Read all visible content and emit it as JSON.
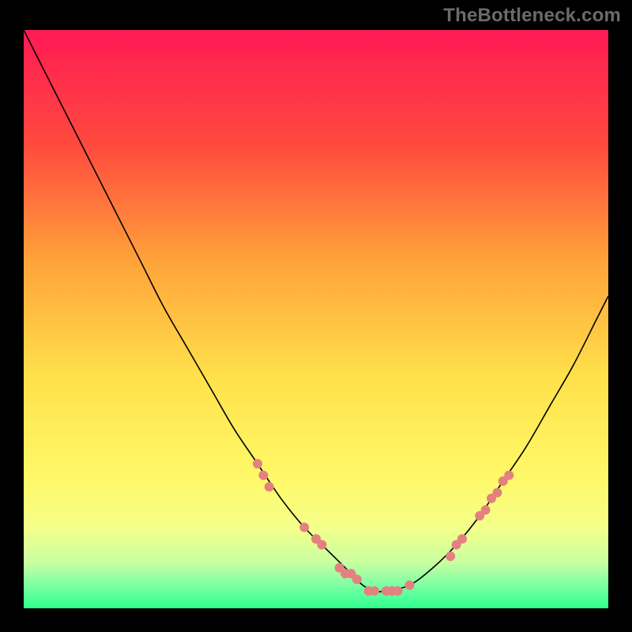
{
  "watermark": "TheBottleneck.com",
  "chart_data": {
    "type": "line",
    "title": "",
    "xlabel": "",
    "ylabel": "",
    "xlim": [
      0,
      100
    ],
    "ylim": [
      0,
      100
    ],
    "gradient_stops": [
      {
        "offset": 0,
        "color": "#ff1a54"
      },
      {
        "offset": 20,
        "color": "#ff4a3e"
      },
      {
        "offset": 40,
        "color": "#ffa33a"
      },
      {
        "offset": 60,
        "color": "#ffe14a"
      },
      {
        "offset": 78,
        "color": "#fff96a"
      },
      {
        "offset": 86,
        "color": "#f4ff8a"
      },
      {
        "offset": 92,
        "color": "#c9ffa0"
      },
      {
        "offset": 96,
        "color": "#7dffa4"
      },
      {
        "offset": 100,
        "color": "#2dff8e"
      }
    ],
    "series": [
      {
        "name": "bottleneck-curve",
        "x": [
          0,
          4,
          8,
          12,
          16,
          20,
          24,
          28,
          32,
          36,
          40,
          44,
          48,
          52,
          56,
          58,
          60,
          62,
          66,
          70,
          74,
          78,
          82,
          86,
          90,
          94,
          98,
          100
        ],
        "y": [
          100,
          92,
          84,
          76,
          68,
          60,
          52,
          45,
          38,
          31,
          25,
          19,
          14,
          10,
          6,
          4,
          3,
          3,
          4,
          7,
          11,
          16,
          22,
          28,
          35,
          42,
          50,
          54
        ],
        "color": "#000000",
        "width": 1.6
      }
    ],
    "markers": {
      "name": "highlight-points",
      "color": "#e58080",
      "radius": 6,
      "points": [
        {
          "x": 40,
          "y": 25
        },
        {
          "x": 41,
          "y": 23
        },
        {
          "x": 42,
          "y": 21
        },
        {
          "x": 48,
          "y": 14
        },
        {
          "x": 50,
          "y": 12
        },
        {
          "x": 51,
          "y": 11
        },
        {
          "x": 54,
          "y": 7
        },
        {
          "x": 55,
          "y": 6
        },
        {
          "x": 56,
          "y": 6
        },
        {
          "x": 57,
          "y": 5
        },
        {
          "x": 59,
          "y": 3
        },
        {
          "x": 60,
          "y": 3
        },
        {
          "x": 62,
          "y": 3
        },
        {
          "x": 63,
          "y": 3
        },
        {
          "x": 64,
          "y": 3
        },
        {
          "x": 66,
          "y": 4
        },
        {
          "x": 73,
          "y": 9
        },
        {
          "x": 74,
          "y": 11
        },
        {
          "x": 75,
          "y": 12
        },
        {
          "x": 78,
          "y": 16
        },
        {
          "x": 79,
          "y": 17
        },
        {
          "x": 80,
          "y": 19
        },
        {
          "x": 81,
          "y": 20
        },
        {
          "x": 82,
          "y": 22
        },
        {
          "x": 83,
          "y": 23
        }
      ]
    }
  }
}
